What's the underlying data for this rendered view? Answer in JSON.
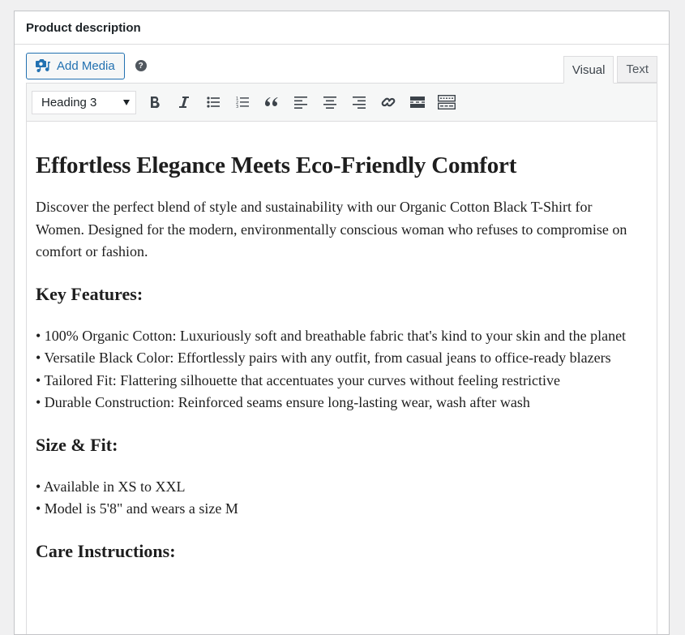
{
  "postbox": {
    "title": "Product description"
  },
  "media": {
    "add_media_label": "Add Media",
    "help_icon": "?"
  },
  "tabs": [
    {
      "label": "Visual",
      "active": true
    },
    {
      "label": "Text",
      "active": false
    }
  ],
  "toolbar": {
    "format_select_value": "Heading 3",
    "buttons": [
      {
        "name": "bold",
        "icon": "bold-icon"
      },
      {
        "name": "italic",
        "icon": "italic-icon"
      },
      {
        "name": "bulleted-list",
        "icon": "bulleted-list-icon"
      },
      {
        "name": "numbered-list",
        "icon": "numbered-list-icon"
      },
      {
        "name": "blockquote",
        "icon": "blockquote-icon"
      },
      {
        "name": "align-left",
        "icon": "align-left-icon"
      },
      {
        "name": "align-center",
        "icon": "align-center-icon"
      },
      {
        "name": "align-right",
        "icon": "align-right-icon"
      },
      {
        "name": "insert-link",
        "icon": "link-icon"
      },
      {
        "name": "read-more",
        "icon": "read-more-icon"
      },
      {
        "name": "toolbar-toggle",
        "icon": "toolbar-toggle-icon"
      }
    ]
  },
  "content": {
    "heading": "Effortless Elegance Meets Eco-Friendly Comfort",
    "intro": "Discover the perfect blend of style and sustainability with our Organic Cotton Black T-Shirt for Women. Designed for the modern, environmentally conscious woman who refuses to compromise on comfort or fashion.",
    "key_features_heading": "Key Features:",
    "key_features": [
      "• 100% Organic Cotton: Luxuriously soft and breathable fabric that's kind to your skin and the planet",
      "• Versatile Black Color: Effortlessly pairs with any outfit, from casual jeans to office-ready blazers",
      "• Tailored Fit: Flattering silhouette that accentuates your curves without feeling restrictive",
      "• Durable Construction: Reinforced seams ensure long-lasting wear, wash after wash"
    ],
    "size_heading": "Size & Fit:",
    "size_items": [
      "• Available in XS to XXL",
      "• Model is 5'8\" and wears a size M"
    ],
    "care_heading": "Care Instructions:"
  },
  "colors": {
    "accent": "#2271b1",
    "page_bg": "#f0f0f1",
    "toolbar_bg": "#f6f7f7",
    "border": "#dcdcde",
    "text": "#1e1e1e"
  }
}
